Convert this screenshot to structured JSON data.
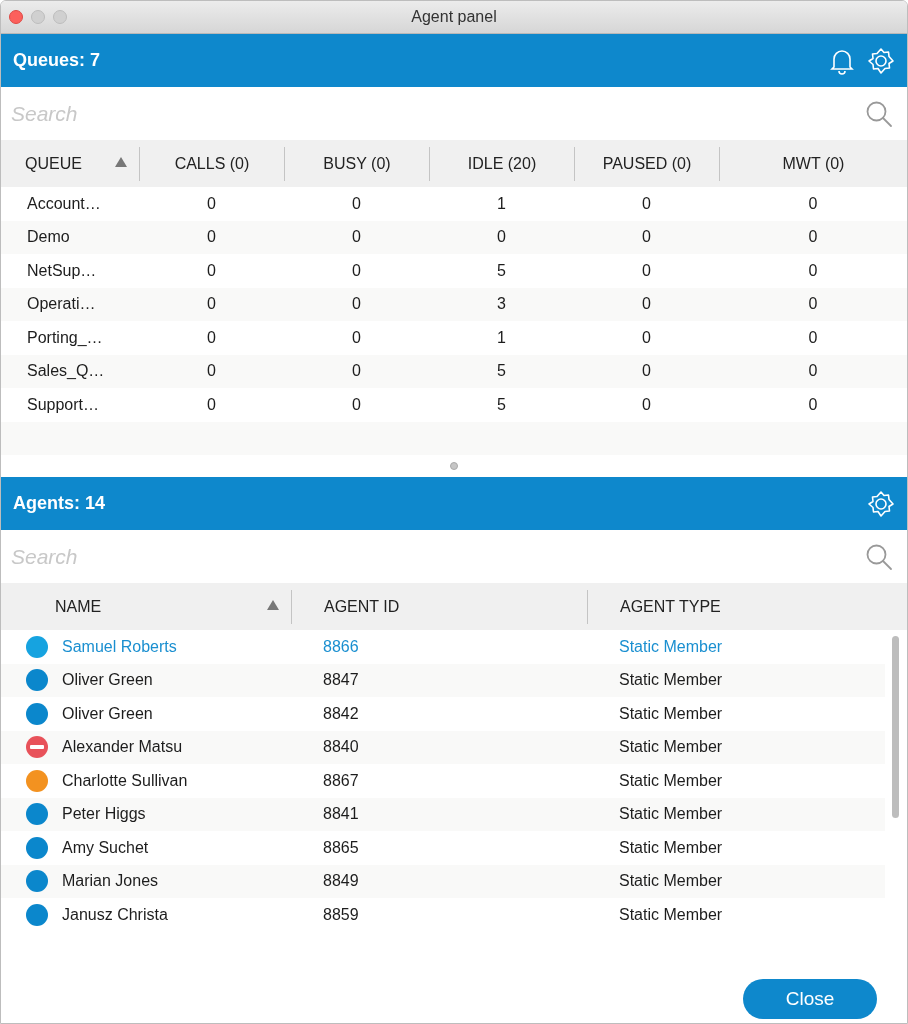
{
  "window": {
    "title": "Agent panel"
  },
  "queues": {
    "title": "Queues: 7",
    "search": {
      "placeholder": "Search"
    },
    "columns": [
      {
        "label": "QUEUE",
        "sorted": true
      },
      {
        "label": "CALLS (0)",
        "sorted": false
      },
      {
        "label": "BUSY (0)",
        "sorted": false
      },
      {
        "label": "IDLE (20)",
        "sorted": false
      },
      {
        "label": "PAUSED (0)",
        "sorted": false
      },
      {
        "label": "MWT (0)",
        "sorted": false
      }
    ],
    "rows": [
      [
        "Account…",
        "0",
        "0",
        "1",
        "0",
        "0"
      ],
      [
        "Demo",
        "0",
        "0",
        "0",
        "0",
        "0"
      ],
      [
        "NetSup…",
        "0",
        "0",
        "5",
        "0",
        "0"
      ],
      [
        "Operati…",
        "0",
        "0",
        "3",
        "0",
        "0"
      ],
      [
        "Porting_…",
        "0",
        "0",
        "1",
        "0",
        "0"
      ],
      [
        "Sales_Q…",
        "0",
        "0",
        "5",
        "0",
        "0"
      ],
      [
        "Support…",
        "0",
        "0",
        "5",
        "0",
        "0"
      ]
    ]
  },
  "agents": {
    "title": "Agents: 14",
    "search": {
      "placeholder": "Search"
    },
    "columns": [
      {
        "label": "NAME",
        "sorted": true
      },
      {
        "label": "AGENT ID",
        "sorted": false
      },
      {
        "label": "AGENT TYPE",
        "sorted": false
      }
    ],
    "rows": [
      {
        "kind": "dot",
        "color": "#16a3e0",
        "name": "Samuel Roberts",
        "id": "8866",
        "type": "Static Member",
        "selected": true
      },
      {
        "kind": "dot",
        "color": "#0b87cc",
        "name": "Oliver Green",
        "id": "8847",
        "type": "Static Member",
        "selected": false
      },
      {
        "kind": "dot",
        "color": "#0b87cc",
        "name": "Oliver Green",
        "id": "8842",
        "type": "Static Member",
        "selected": false
      },
      {
        "kind": "blocked",
        "color": "#e8525a",
        "name": "Alexander Matsu",
        "id": "8840",
        "type": "Static Member",
        "selected": false
      },
      {
        "kind": "dot",
        "color": "#f39220",
        "name": "Charlotte Sullivan",
        "id": "8867",
        "type": "Static Member",
        "selected": false
      },
      {
        "kind": "dot",
        "color": "#0b87cc",
        "name": "Peter Higgs",
        "id": "8841",
        "type": "Static Member",
        "selected": false
      },
      {
        "kind": "dot",
        "color": "#0b87cc",
        "name": "Amy Suchet",
        "id": "8865",
        "type": "Static Member",
        "selected": false
      },
      {
        "kind": "dot",
        "color": "#0b87cc",
        "name": "Marian Jones",
        "id": "8849",
        "type": "Static Member",
        "selected": false
      },
      {
        "kind": "dot",
        "color": "#0b87cc",
        "name": "Janusz Christa",
        "id": "8859",
        "type": "Static Member",
        "selected": false
      }
    ]
  },
  "buttons": [
    {
      "label": "Close"
    }
  ]
}
